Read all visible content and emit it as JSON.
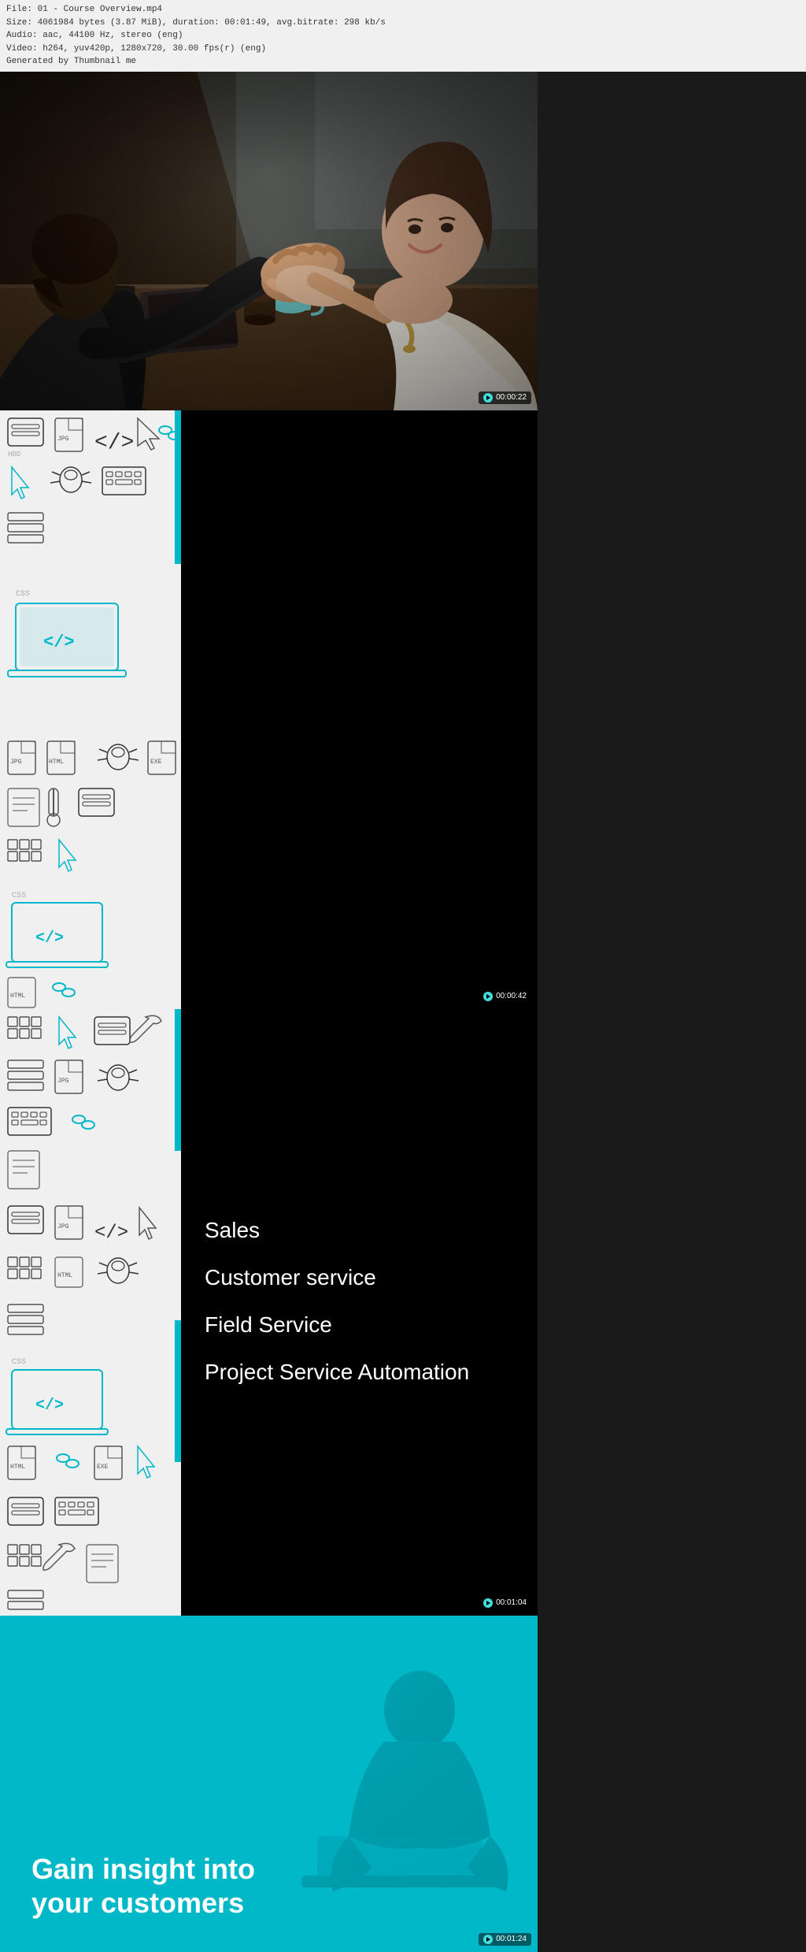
{
  "fileInfo": {
    "line1": "File: 01 - Course Overview.mp4",
    "line2": "Size: 4061984 bytes (3.87 MiB), duration: 00:01:49, avg.bitrate: 298 kb/s",
    "line3": "Audio: aac, 44100 Hz, stereo (eng)",
    "line4": "Video: h264, yuv420p, 1280x720, 30.00 fps(r) (eng)",
    "line5": "Generated by Thumbnail me"
  },
  "timestamps": {
    "thumb1": "00:00:22",
    "thumb2": "00:00:42",
    "thumb3": "00:01:04",
    "thumb4": "00:01:24"
  },
  "listItems": {
    "item1": "Sales",
    "item2": "Customer service",
    "item3": "Field Service",
    "item4": "Project Service Automation"
  },
  "tealSection": {
    "headline": "Gain insight into your customers"
  },
  "colors": {
    "teal": "#00b8c8",
    "black": "#000000",
    "white": "#ffffff",
    "lightGray": "#f5f5f5"
  }
}
